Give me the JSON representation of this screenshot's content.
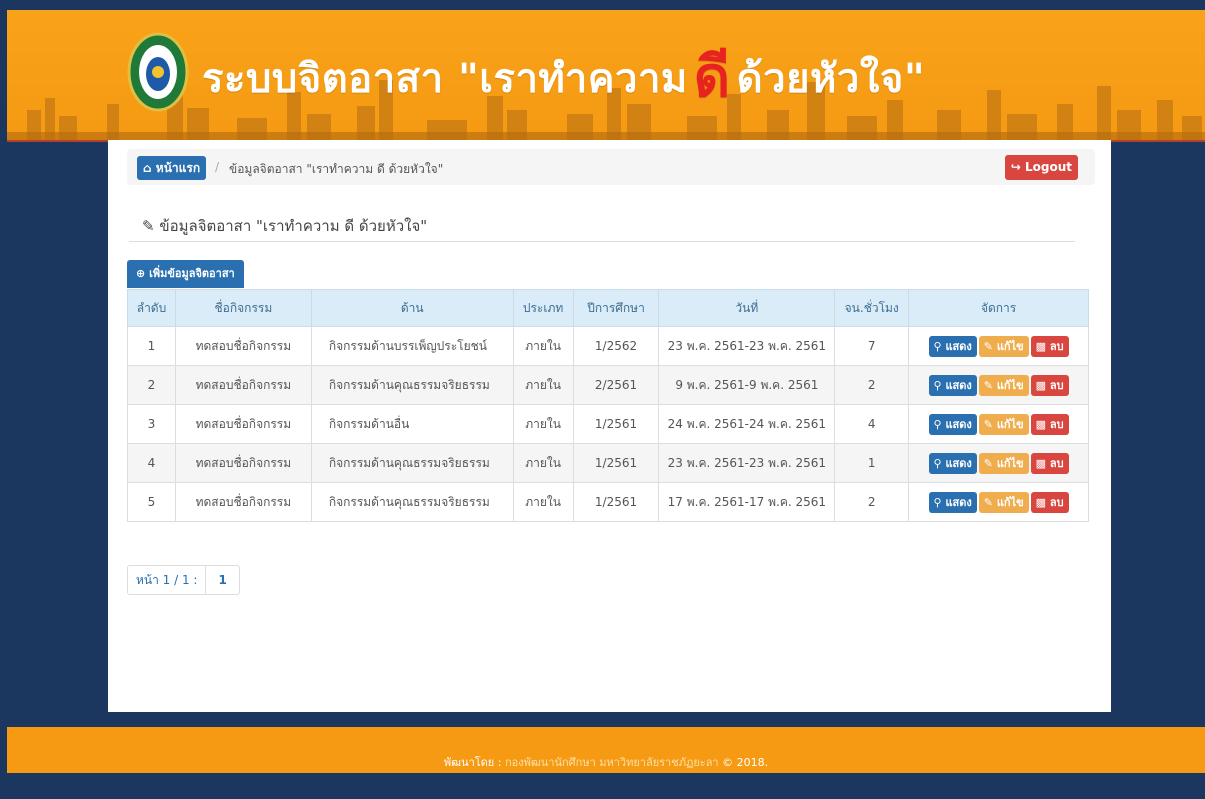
{
  "header": {
    "title_before": "ระบบจิตอาสา \"เราทำความ",
    "title_red": "ดี",
    "title_after": "ด้วยหัวใจ\""
  },
  "breadcrumb": {
    "home_label": "หน้าแรก",
    "current": "ข้อมูลจิตอาสา \"เราทำความ ดี ด้วยหัวใจ\"",
    "logout_label": "Logout"
  },
  "section": {
    "title": "ข้อมูลจิตอาสา \"เราทำความ ดี ด้วยหัวใจ\"",
    "add_button": "เพิ่มข้อมูลจิตอาสา"
  },
  "table": {
    "headers": [
      "ลำดับ",
      "ชื่อกิจกรรม",
      "ด้าน",
      "ประเภท",
      "ปีการศึกษา",
      "วันที่",
      "จน.ชั่วโมง",
      "จัดการ"
    ],
    "rows": [
      {
        "no": "1",
        "name": "ทดสอบชื่อกิจกรรม",
        "side": "กิจกรรมด้านบรรเพ็ญประโยชน์",
        "type": "ภายใน",
        "year": "1/2562",
        "date": "23 พ.ค. 2561-23 พ.ค. 2561",
        "hours": "7"
      },
      {
        "no": "2",
        "name": "ทดสอบชื่อกิจกรรม",
        "side": "กิจกรรมด้านคุณธรรมจริยธรรม",
        "type": "ภายใน",
        "year": "2/2561",
        "date": "9 พ.ค. 2561-9 พ.ค. 2561",
        "hours": "2"
      },
      {
        "no": "3",
        "name": "ทดสอบชื่อกิจกรรม",
        "side": "กิจกรรมด้านอื่น",
        "type": "ภายใน",
        "year": "1/2561",
        "date": "24 พ.ค. 2561-24 พ.ค. 2561",
        "hours": "4"
      },
      {
        "no": "4",
        "name": "ทดสอบชื่อกิจกรรม",
        "side": "กิจกรรมด้านคุณธรรมจริยธรรม",
        "type": "ภายใน",
        "year": "1/2561",
        "date": "23 พ.ค. 2561-23 พ.ค. 2561",
        "hours": "1"
      },
      {
        "no": "5",
        "name": "ทดสอบชื่อกิจกรรม",
        "side": "กิจกรรมด้านคุณธรรมจริยธรรม",
        "type": "ภายใน",
        "year": "1/2561",
        "date": "17 พ.ค. 2561-17 พ.ค. 2561",
        "hours": "2"
      }
    ],
    "actions": {
      "view": "แสดง",
      "edit": "แก้ไข",
      "delete": "ลบ"
    }
  },
  "pager": {
    "info": "หน้า 1 / 1 :",
    "page": "1"
  },
  "footer": {
    "prefix": "พัฒนาโดย :",
    "org": "กองพัฒนานักศึกษา มหาวิทยาลัยราชภัฏยะลา",
    "suffix": "© 2018."
  },
  "colors": {
    "header": "#f59a12",
    "background": "#1b375f",
    "primary": "#2a6fb0",
    "warning": "#f0ad4e",
    "danger": "#d9463f"
  },
  "icons": {
    "home": "home-icon",
    "logout": "sign-out-icon",
    "edit_title": "edit-icon",
    "add": "plus-circle-icon",
    "view": "search-icon",
    "edit": "edit-icon",
    "delete": "trash-icon"
  }
}
